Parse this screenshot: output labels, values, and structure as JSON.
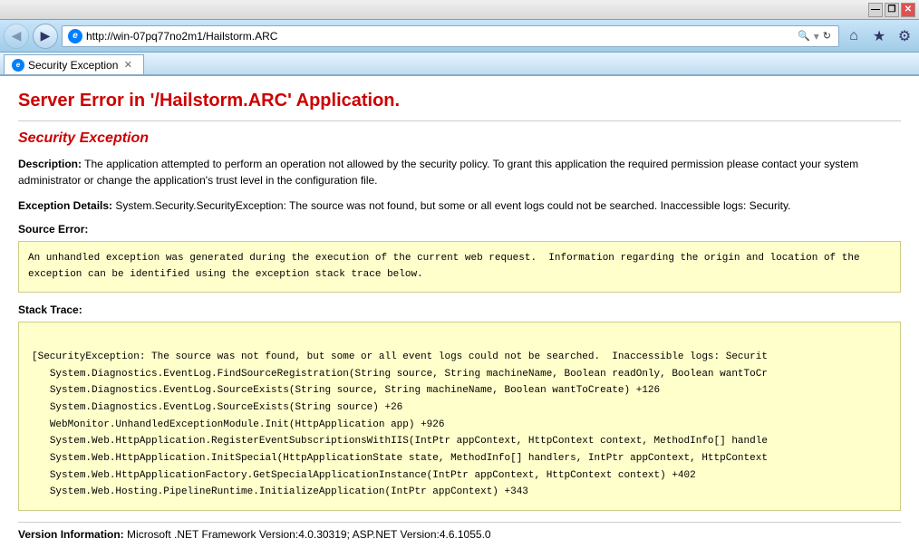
{
  "titlebar": {
    "min_label": "—",
    "max_label": "❐",
    "close_label": "✕"
  },
  "navbar": {
    "back_label": "◀",
    "forward_label": "▶",
    "address": "http://win-07pq77no2m1/Hailstorm.ARC",
    "search_label": "🔍",
    "refresh_label": "↻",
    "home_label": "⌂",
    "favorites_label": "★",
    "tools_label": "⚙"
  },
  "tab": {
    "label": "Security Exception",
    "close_label": "✕"
  },
  "page": {
    "server_error_title": "Server Error in '/Hailstorm.ARC' Application.",
    "exception_type": "Security Exception",
    "description_label": "Description:",
    "description_text": "The application attempted to perform an operation not allowed by the security policy.  To grant this application the required permission please contact your system administrator or change the application's trust level in the configuration file.",
    "exception_details_label": "Exception Details:",
    "exception_details_text": "System.Security.SecurityException: The source was not found, but some or all event logs could not be searched.  Inaccessible logs: Security.",
    "source_error_label": "Source Error:",
    "source_error_text": "An unhandled exception was generated during the execution of the current web request.  Information regarding the origin and location of the\nexception can be identified using the exception stack trace below.",
    "stack_trace_label": "Stack Trace:",
    "stack_trace_text": "\n[SecurityException: The source was not found, but some or all event logs could not be searched.  Inaccessible logs: Securit\n   System.Diagnostics.EventLog.FindSourceRegistration(String source, String machineName, Boolean readOnly, Boolean wantToCr\n   System.Diagnostics.EventLog.SourceExists(String source, String machineName, Boolean wantToCreate) +126\n   System.Diagnostics.EventLog.SourceExists(String source) +26\n   WebMonitor.UnhandledExceptionModule.Init(HttpApplication app) +926\n   System.Web.HttpApplication.RegisterEventSubscriptionsWithIIS(IntPtr appContext, HttpContext context, MethodInfo[] handle\n   System.Web.HttpApplication.InitSpecial(HttpApplicationState state, MethodInfo[] handlers, IntPtr appContext, HttpContext\n   System.Web.HttpApplicationFactory.GetSpecialApplicationInstance(IntPtr appContext, HttpContext context) +402\n   System.Web.Hosting.PipelineRuntime.InitializeApplication(IntPtr appContext) +343\n",
    "version_label": "Version Information:",
    "version_text": "Microsoft .NET Framework Version:4.0.30319; ASP.NET Version:4.6.1055.0"
  }
}
